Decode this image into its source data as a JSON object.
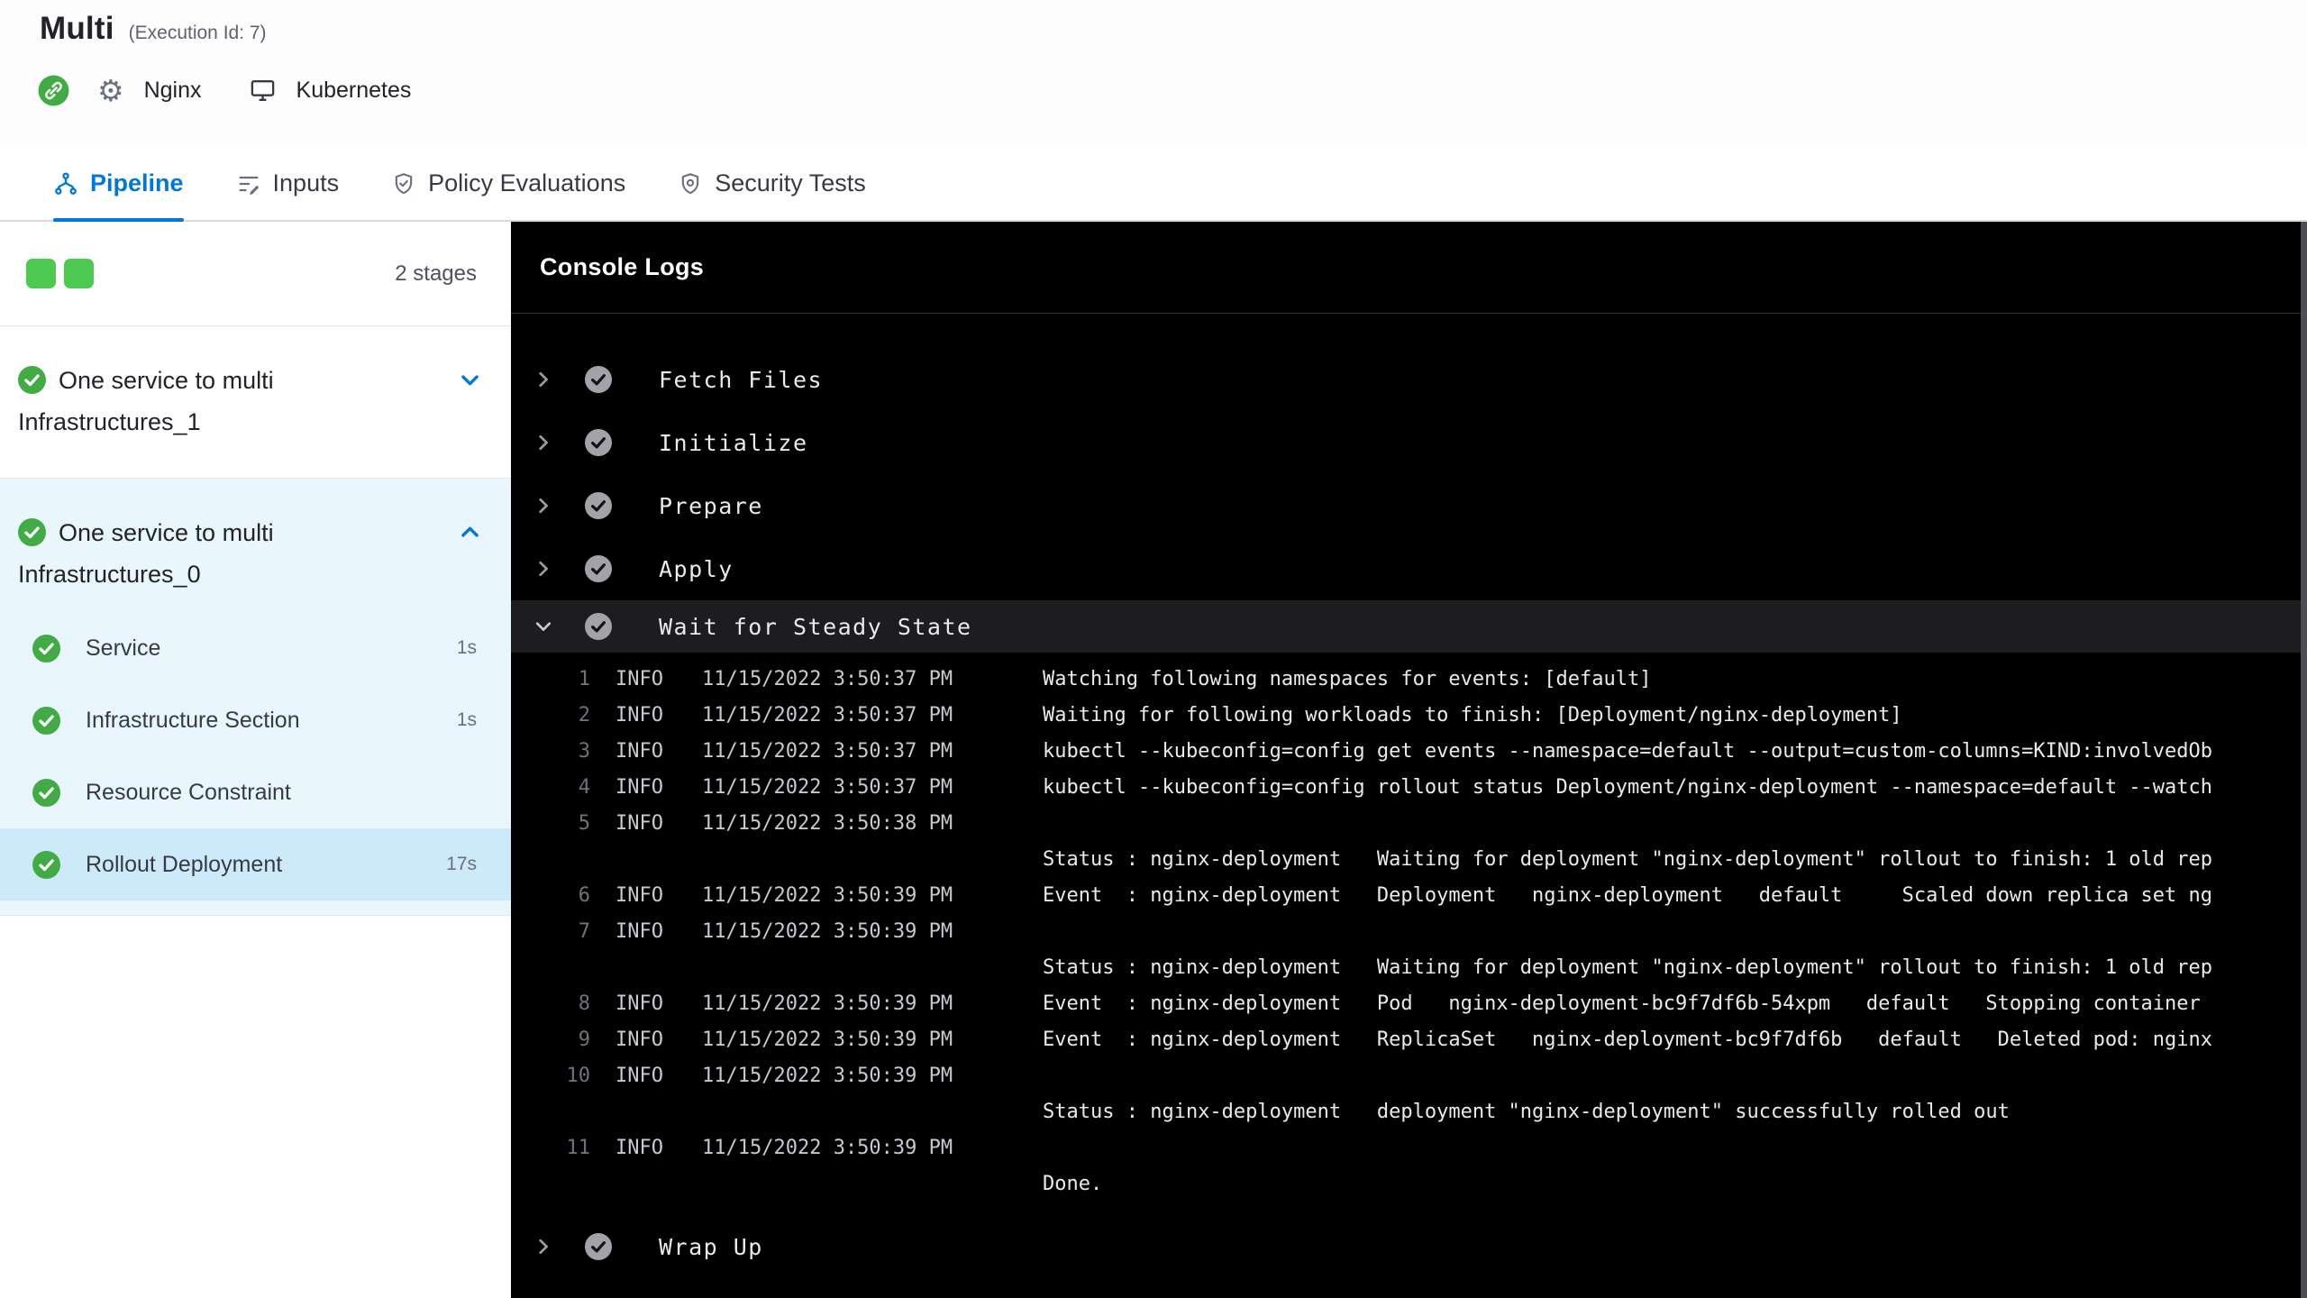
{
  "header": {
    "title": "Multi",
    "execution_id": "(Execution Id: 7)",
    "service_name": "Nginx",
    "environment_name": "Kubernetes"
  },
  "tabs": [
    {
      "label": "Pipeline",
      "icon": "pipeline-icon",
      "active": true
    },
    {
      "label": "Inputs",
      "icon": "inputs-icon",
      "active": false
    },
    {
      "label": "Policy Evaluations",
      "icon": "policy-icon",
      "active": false
    },
    {
      "label": "Security Tests",
      "icon": "security-icon",
      "active": false
    }
  ],
  "stage_panel": {
    "stage_count": "2 stages",
    "stages": [
      {
        "name": "One service to multi Infrastructures_1",
        "status": "success",
        "expanded": false,
        "steps": []
      },
      {
        "name": "One service to multi Infrastructures_0",
        "status": "success",
        "expanded": true,
        "steps": [
          {
            "name": "Service",
            "duration": "1s",
            "status": "success",
            "selected": false
          },
          {
            "name": "Infrastructure Section",
            "duration": "1s",
            "status": "success",
            "selected": false
          },
          {
            "name": "Resource Constraint",
            "duration": "",
            "status": "success",
            "selected": false
          },
          {
            "name": "Rollout Deployment",
            "duration": "17s",
            "status": "success",
            "selected": true
          }
        ]
      }
    ]
  },
  "console": {
    "title": "Console Logs",
    "steps": [
      {
        "name": "Fetch Files",
        "status": "success",
        "expanded": false
      },
      {
        "name": "Initialize",
        "status": "success",
        "expanded": false
      },
      {
        "name": "Prepare",
        "status": "success",
        "expanded": false
      },
      {
        "name": "Apply",
        "status": "success",
        "expanded": false
      },
      {
        "name": "Wait for Steady State",
        "status": "success",
        "expanded": true,
        "logs": [
          {
            "num": "1",
            "level": "INFO",
            "time": "11/15/2022 3:50:37 PM",
            "lines": [
              "Watching following namespaces for events: [default]"
            ]
          },
          {
            "num": "2",
            "level": "INFO",
            "time": "11/15/2022 3:50:37 PM",
            "lines": [
              "Waiting for following workloads to finish: [Deployment/nginx-deployment]"
            ]
          },
          {
            "num": "3",
            "level": "INFO",
            "time": "11/15/2022 3:50:37 PM",
            "lines": [
              "kubectl --kubeconfig=config get events --namespace=default --output=custom-columns=KIND:involvedOb"
            ]
          },
          {
            "num": "4",
            "level": "INFO",
            "time": "11/15/2022 3:50:37 PM",
            "lines": [
              "kubectl --kubeconfig=config rollout status Deployment/nginx-deployment --namespace=default --watch"
            ]
          },
          {
            "num": "5",
            "level": "INFO",
            "time": "11/15/2022 3:50:38 PM",
            "lines": [
              "",
              "Status : nginx-deployment   Waiting for deployment \"nginx-deployment\" rollout to finish: 1 old rep"
            ]
          },
          {
            "num": "6",
            "level": "INFO",
            "time": "11/15/2022 3:50:39 PM",
            "lines": [
              "Event  : nginx-deployment   Deployment   nginx-deployment   default     Scaled down replica set ng"
            ]
          },
          {
            "num": "7",
            "level": "INFO",
            "time": "11/15/2022 3:50:39 PM",
            "lines": [
              "",
              "Status : nginx-deployment   Waiting for deployment \"nginx-deployment\" rollout to finish: 1 old rep"
            ]
          },
          {
            "num": "8",
            "level": "INFO",
            "time": "11/15/2022 3:50:39 PM",
            "lines": [
              "Event  : nginx-deployment   Pod   nginx-deployment-bc9f7df6b-54xpm   default   Stopping container"
            ]
          },
          {
            "num": "9",
            "level": "INFO",
            "time": "11/15/2022 3:50:39 PM",
            "lines": [
              "Event  : nginx-deployment   ReplicaSet   nginx-deployment-bc9f7df6b   default   Deleted pod: nginx"
            ]
          },
          {
            "num": "10",
            "level": "INFO",
            "time": "11/15/2022 3:50:39 PM",
            "lines": [
              "",
              "Status : nginx-deployment   deployment \"nginx-deployment\" successfully rolled out"
            ]
          },
          {
            "num": "11",
            "level": "INFO",
            "time": "11/15/2022 3:50:39 PM",
            "lines": [
              "",
              "Done."
            ]
          }
        ]
      },
      {
        "name": "Wrap Up",
        "status": "success",
        "expanded": false
      }
    ]
  },
  "colors": {
    "accent_blue": "#0278d5",
    "success_green": "#42ab45",
    "stage_square_green": "#4dc952",
    "expanded_stage_bg": "#e9f6fe",
    "selected_step_bg": "#cdeafa",
    "console_bg": "#000000",
    "console_expanded_row_bg": "#1d1d21"
  }
}
